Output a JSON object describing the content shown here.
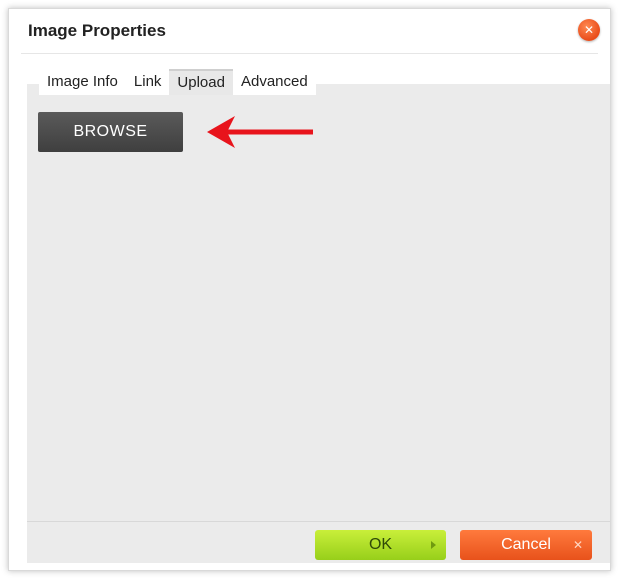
{
  "dialog": {
    "title": "Image Properties",
    "close_icon": "close-icon",
    "close_glyph": "✕"
  },
  "tabs": [
    {
      "label": "Image Info",
      "active": false
    },
    {
      "label": "Link",
      "active": false
    },
    {
      "label": "Upload",
      "active": true
    },
    {
      "label": "Advanced",
      "active": false
    }
  ],
  "upload": {
    "browse_label": "BROWSE",
    "annotation_icon": "red-arrow-left-icon",
    "annotation_color": "#e8141c"
  },
  "footer": {
    "ok_label": "OK",
    "ok_icon": "play-right-icon",
    "cancel_label": "Cancel",
    "cancel_icon": "x-icon",
    "cancel_glyph": "✕"
  },
  "colors": {
    "ok_button": "#aadf22",
    "cancel_button": "#f0611f",
    "browse_button": "#4a4a4a",
    "panel_background": "#ebebeb"
  }
}
